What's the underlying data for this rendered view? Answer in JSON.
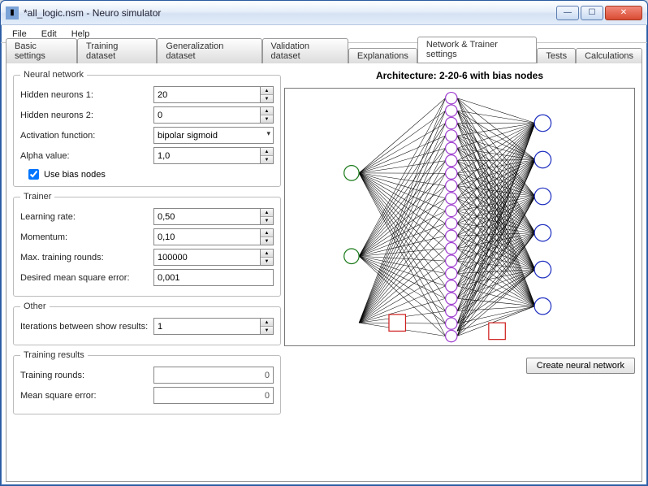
{
  "window": {
    "title": "*all_logic.nsm - Neuro simulator"
  },
  "menu": {
    "file": "File",
    "edit": "Edit",
    "help": "Help"
  },
  "tabs": {
    "basic": "Basic settings",
    "train": "Training dataset",
    "gen": "Generalization dataset",
    "valid": "Validation dataset",
    "expl": "Explanations",
    "net": "Network & Trainer settings",
    "tests": "Tests",
    "calc": "Calculations"
  },
  "groups": {
    "neural_network": "Neural network",
    "trainer": "Trainer",
    "other": "Other",
    "results": "Training results"
  },
  "neural": {
    "hidden1_label": "Hidden neurons 1:",
    "hidden1": "20",
    "hidden2_label": "Hidden neurons 2:",
    "hidden2": "0",
    "activation_label": "Activation function:",
    "activation": "bipolar sigmoid",
    "alpha_label": "Alpha value:",
    "alpha": "1,0",
    "bias_label": "Use bias nodes",
    "bias_checked": true
  },
  "trainer": {
    "lr_label": "Learning rate:",
    "lr": "0,50",
    "mom_label": "Momentum:",
    "mom": "0,10",
    "max_label": "Max. training rounds:",
    "max": "100000",
    "mse_label": "Desired mean square error:",
    "mse": "0,001"
  },
  "other": {
    "iter_label": "Iterations between show results:",
    "iter": "1"
  },
  "results": {
    "rounds_label": "Training rounds:",
    "rounds": "0",
    "mse_label": "Mean square error:",
    "mse": "0"
  },
  "right": {
    "arch_title": "Architecture: 2-20-6 with bias nodes",
    "create_btn": "Create neural network"
  },
  "net_diagram": {
    "inputs": 2,
    "hidden": 20,
    "outputs": 6,
    "bias": true
  }
}
